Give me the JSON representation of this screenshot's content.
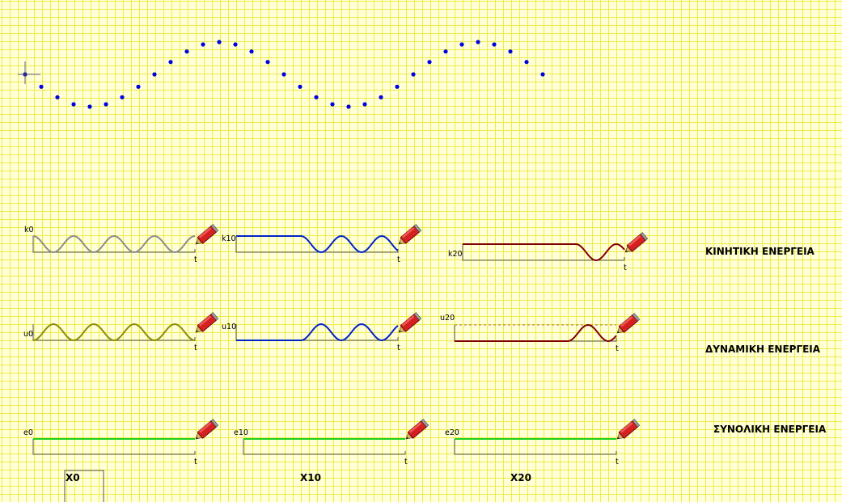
{
  "wave": {
    "point_count": 33,
    "dot_color": "#0000e0",
    "origin_marker": "crosshair-icon"
  },
  "panels": [
    {
      "id": "k0",
      "label": "k0",
      "axis_label": "t",
      "color": "#8c8c8c",
      "delay": 0,
      "kind": "kinetic"
    },
    {
      "id": "k10",
      "label": "k10",
      "axis_label": "t",
      "color": "#0024c8",
      "delay": 0.4,
      "kind": "kinetic"
    },
    {
      "id": "k20",
      "label": "k20",
      "axis_label": "t",
      "color": "#800000",
      "delay": 0.7,
      "kind": "kinetic"
    },
    {
      "id": "u0",
      "label": "u0",
      "axis_label": "t",
      "color": "#8c8c00",
      "delay": 0,
      "kind": "potential"
    },
    {
      "id": "u10",
      "label": "u10",
      "axis_label": "t",
      "color": "#0024c8",
      "delay": 0.4,
      "kind": "potential"
    },
    {
      "id": "u20",
      "label": "u20",
      "axis_label": "t",
      "color": "#800000",
      "delay": 0.7,
      "kind": "potential"
    },
    {
      "id": "e0",
      "label": "e0",
      "axis_label": "t",
      "color": "#1ed21e",
      "delay": 0,
      "kind": "total"
    },
    {
      "id": "e10",
      "label": "e10",
      "axis_label": "t",
      "color": "#1ed21e",
      "delay": 0,
      "kind": "total"
    },
    {
      "id": "e20",
      "label": "e20",
      "axis_label": "t",
      "color": "#1ed21e",
      "delay": 0,
      "kind": "total"
    }
  ],
  "pencil_icon": "pencil-icon",
  "row_titles": {
    "kinetic": "ΚΙΝΗΤΙΚΗ ΕΝΕΡΓΕΙΑ",
    "potential": "ΔΥΝΑΜΙΚΗ ΕΝΕΡΓΕΙΑ",
    "total": "ΣΥΝΟΛΙΚΗ ΕΝΕΡΓΕΙΑ"
  },
  "column_titles": {
    "x0": "X0",
    "x10": "X10",
    "x20": "X20"
  }
}
